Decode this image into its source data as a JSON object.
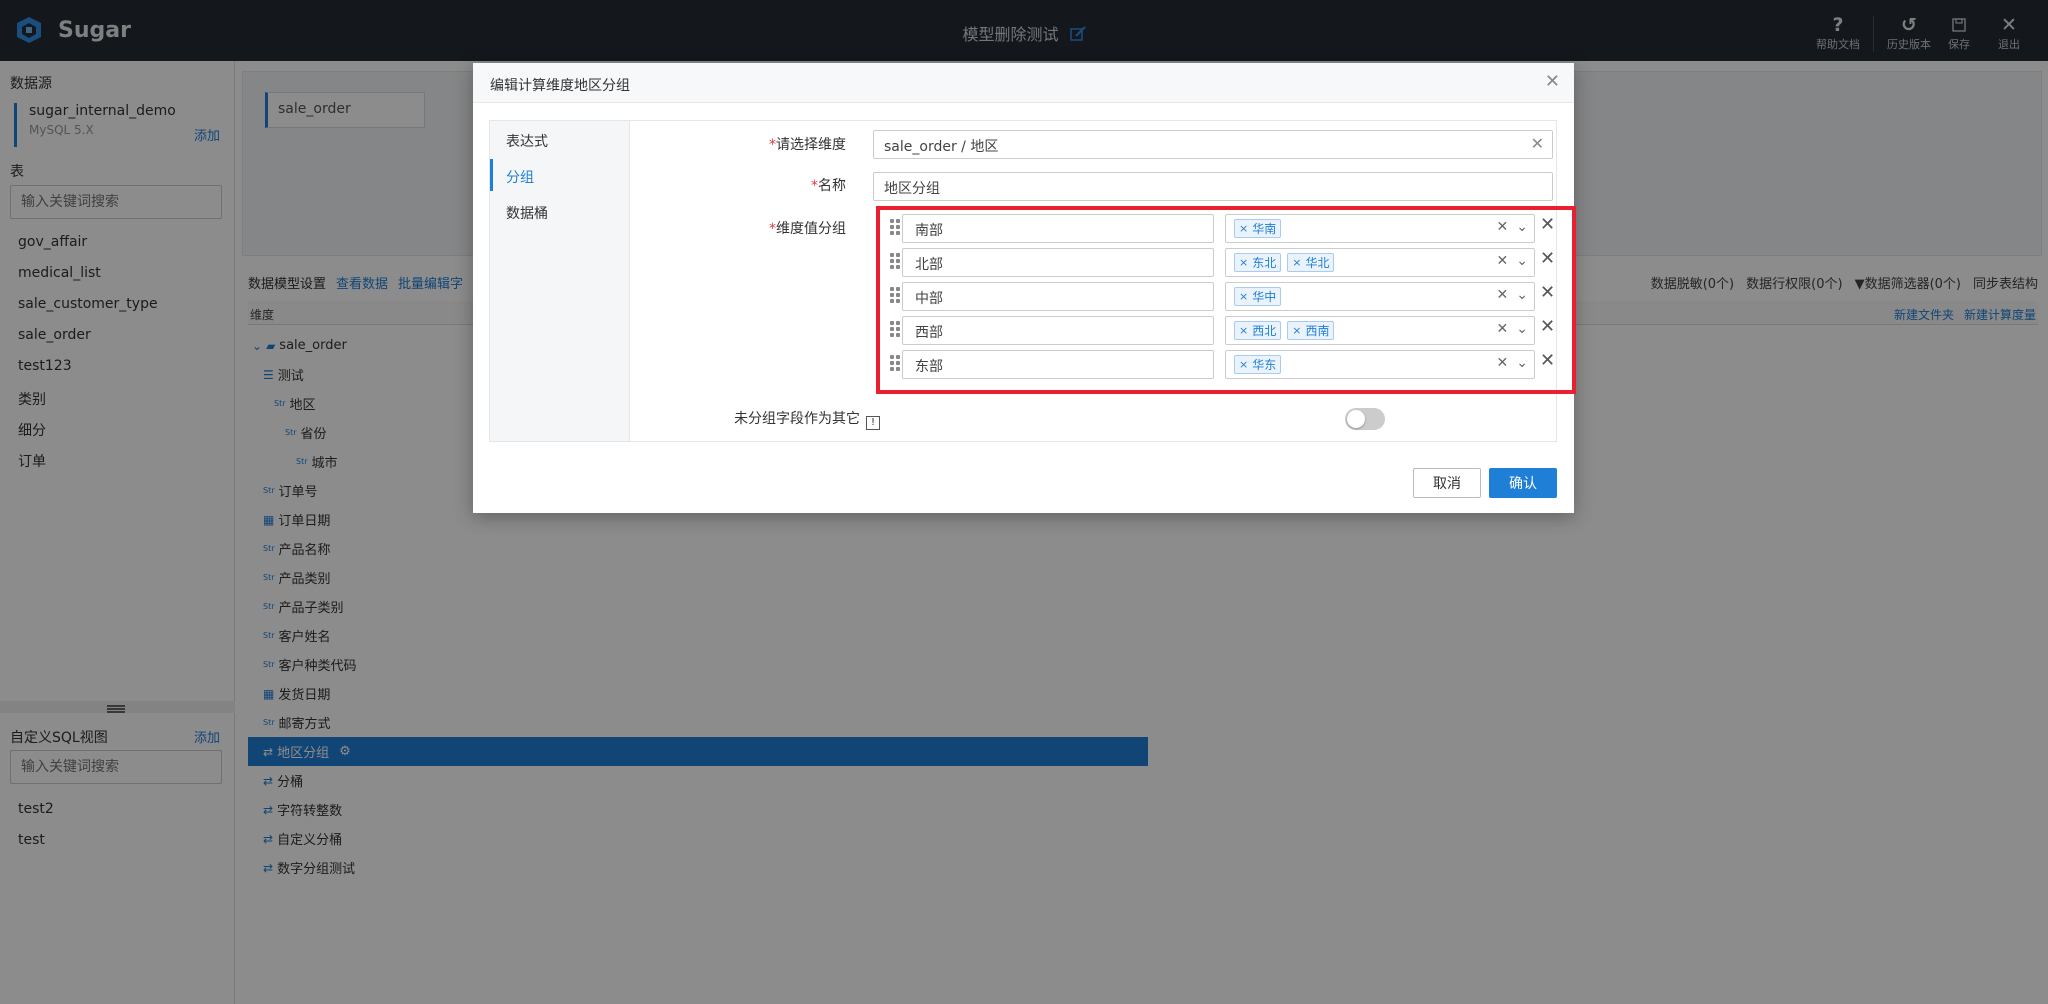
{
  "app": {
    "name": "Sugar",
    "page_title": "模型删除测试"
  },
  "top_actions": [
    {
      "icon": "help-icon",
      "label": "帮助文档"
    },
    {
      "icon": "history-icon",
      "label": "历史版本"
    },
    {
      "icon": "save-icon",
      "label": "保存"
    },
    {
      "icon": "exit-icon",
      "label": "退出"
    }
  ],
  "sidebar": {
    "datasource_heading": "数据源",
    "datasource_name": "sugar_internal_demo",
    "datasource_type": "MySQL 5.X",
    "add_label": "添加",
    "tables_heading": "表",
    "search_placeholder": "输入关键词搜索",
    "tables": [
      "gov_affair",
      "medical_list",
      "sale_customer_type",
      "sale_order",
      "test123",
      "类别",
      "细分",
      "订单"
    ],
    "sql_heading": "自定义SQL视图",
    "sql_add_label": "添加",
    "sql_search_placeholder": "输入关键词搜索",
    "sql_views": [
      "test2",
      "test"
    ]
  },
  "main": {
    "table_chip": "sale_order",
    "toolbar_left": [
      "数据模型设置",
      "查看数据",
      "批量编辑字"
    ],
    "toolbar_right": [
      "数据脱敏(0个)",
      "数据行权限(0个)",
      "数据筛选器(0个)",
      "同步表结构"
    ],
    "column_header": "维度",
    "header_links": [
      "新建文件夹",
      "新建计算度量"
    ],
    "tree": [
      {
        "label": "sale_order",
        "type": "folder",
        "indent": 0
      },
      {
        "label": "测试",
        "type": "hier",
        "indent": 1
      },
      {
        "label": "地区",
        "type": "str",
        "indent": 2
      },
      {
        "label": "省份",
        "type": "str",
        "indent": 3
      },
      {
        "label": "城市",
        "type": "str",
        "indent": 4
      },
      {
        "label": "订单号",
        "type": "str",
        "indent": 1
      },
      {
        "label": "订单日期",
        "type": "date",
        "indent": 1
      },
      {
        "label": "产品名称",
        "type": "str",
        "indent": 1
      },
      {
        "label": "产品类别",
        "type": "str",
        "indent": 1
      },
      {
        "label": "产品子类别",
        "type": "str",
        "indent": 1
      },
      {
        "label": "客户姓名",
        "type": "str",
        "indent": 1
      },
      {
        "label": "客户种类代码",
        "type": "str",
        "indent": 1
      },
      {
        "label": "发货日期",
        "type": "date",
        "indent": 1
      },
      {
        "label": "邮寄方式",
        "type": "str",
        "indent": 1
      },
      {
        "label": "地区分组",
        "type": "calc",
        "indent": 1,
        "selected": true
      },
      {
        "label": "分桶",
        "type": "calc",
        "indent": 1
      },
      {
        "label": "字符转整数",
        "type": "calc",
        "indent": 1
      },
      {
        "label": "自定义分桶",
        "type": "calc",
        "indent": 1
      },
      {
        "label": "数字分组测试",
        "type": "calc",
        "indent": 1
      }
    ]
  },
  "modal": {
    "title": "编辑计算维度地区分组",
    "tabs": [
      "表达式",
      "分组",
      "数据桶"
    ],
    "active_tab": 1,
    "fields": {
      "dimension_label": "请选择维度",
      "dimension_value": "sale_order / 地区",
      "name_label": "名称",
      "name_value": "地区分组",
      "groups_label": "维度值分组",
      "other_label": "未分组字段作为其它"
    },
    "groups": [
      {
        "name": "南部",
        "values": [
          "华南"
        ]
      },
      {
        "name": "北部",
        "values": [
          "东北",
          "华北"
        ]
      },
      {
        "name": "中部",
        "values": [
          "华中"
        ]
      },
      {
        "name": "西部",
        "values": [
          "西北",
          "西南"
        ]
      },
      {
        "name": "东部",
        "values": [
          "华东"
        ]
      }
    ],
    "cancel_label": "取消",
    "ok_label": "确认"
  }
}
